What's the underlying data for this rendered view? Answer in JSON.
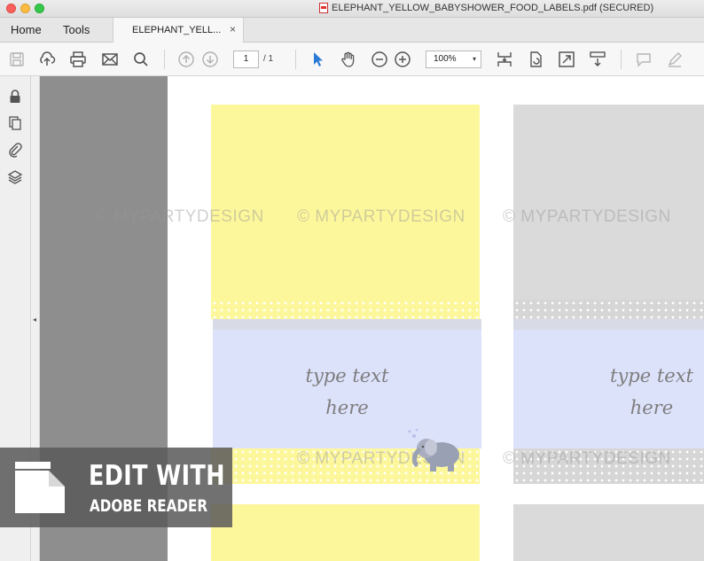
{
  "window": {
    "title": "ELEPHANT_YELLOW_BABYSHOWER_FOOD_LABELS.pdf (SECURED)"
  },
  "menu": {
    "home": "Home",
    "tools": "Tools"
  },
  "tab": {
    "label": "ELEPHANT_YELL...",
    "close": "×"
  },
  "toolbar": {
    "page_current": "1",
    "page_total": "/ 1",
    "zoom": "100%",
    "zoom_caret": "▾",
    "icons": [
      "save-icon",
      "upload-icon",
      "print-icon",
      "email-icon",
      "search-icon",
      "page-up-icon",
      "page-down-icon",
      "select-arrow-icon",
      "hand-icon",
      "zoom-out-icon",
      "zoom-in-icon",
      "fit-page-icon",
      "rotate-icon",
      "full-screen-icon",
      "scroll-mode-icon",
      "comment-icon",
      "sign-icon"
    ]
  },
  "leftnav": {
    "icons": [
      "lock-icon",
      "pages-icon",
      "attachment-icon",
      "layers-icon"
    ],
    "collapse": "◂"
  },
  "document": {
    "label_text_line1": "type text",
    "label_text_line2": "here",
    "watermark": "© MYPARTYDESIGN",
    "colors": {
      "yellow": "#fdf79c",
      "blue": "#dde2fb",
      "gray": "#dadada"
    }
  },
  "badge": {
    "line1": "EDIT WITH",
    "line2": "ADOBE READER"
  }
}
